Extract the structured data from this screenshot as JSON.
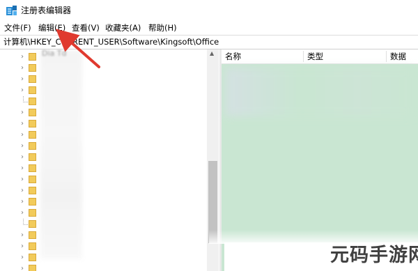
{
  "window": {
    "title": "注册表编辑器",
    "icon": "regedit-icon"
  },
  "menu": [
    {
      "label": "文件(F)"
    },
    {
      "label": "编辑(E)"
    },
    {
      "label": "查看(V)"
    },
    {
      "label": "收藏夹(A)"
    },
    {
      "label": "帮助(H)"
    }
  ],
  "address": {
    "path": "计算机\\HKEY_CURRENT_USER\\Software\\Kingsoft\\Office"
  },
  "tree": {
    "partial_label": "Dia Td",
    "expand_glyph": "›"
  },
  "values_pane": {
    "columns": [
      {
        "label": "名称"
      },
      {
        "label": "类型"
      },
      {
        "label": "数据"
      }
    ],
    "background": "#c9e6d2"
  },
  "annotation": {
    "arrow_color": "#e03a2f",
    "points_to": "编辑(E)"
  },
  "watermark": {
    "text": "元码手游网"
  }
}
